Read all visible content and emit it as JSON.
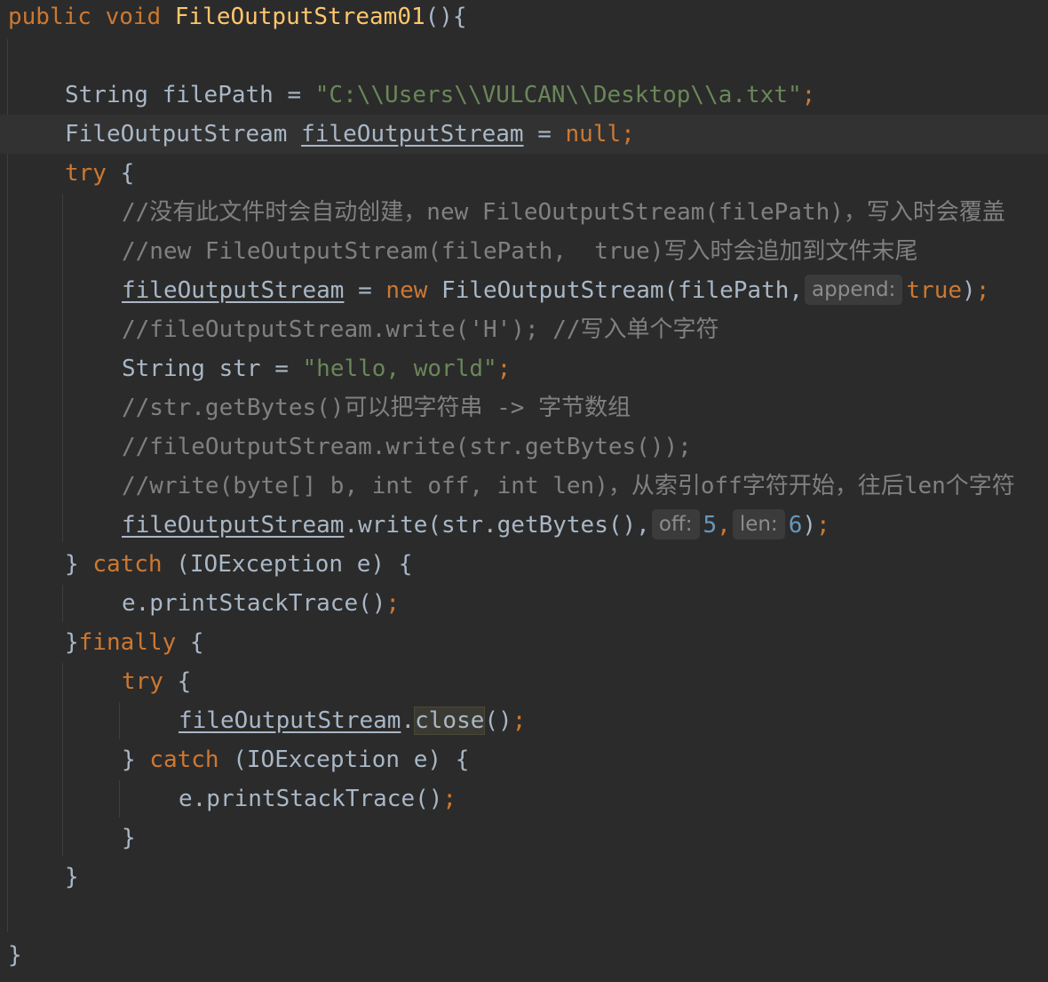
{
  "code": {
    "l1": {
      "mod": "public",
      "type": "void",
      "name": "FileOutputStream01",
      "open": "(){"
    },
    "l3": {
      "type": "String",
      "var": "filePath",
      "eq": " = ",
      "val": "\"C:\\\\Users\\\\VULCAN\\\\Desktop\\\\a.txt\"",
      "semi": ";"
    },
    "l4": {
      "type": "FileOutputStream",
      "var": "fileOutputStream",
      "eq": " = ",
      "val": "null",
      "semi": ";"
    },
    "l5": {
      "kw": "try",
      "rest": " {"
    },
    "l6": {
      "comment": "//没有此文件时会自动创建，new FileOutputStream(filePath)，写入时会覆盖"
    },
    "l7": {
      "comment": "//new FileOutputStream(filePath,  true)写入时会追加到文件末尾"
    },
    "l8": {
      "var": "fileOutputStream",
      "eq": " = ",
      "kw": "new",
      "call": " FileOutputStream(filePath,",
      "hint": "append:",
      "val": "true",
      "close": ")",
      "semi": ";"
    },
    "l9": {
      "comment": "//fileOutputStream.write('H'); //写入单个字符"
    },
    "l10": {
      "type": "String",
      "var": " str",
      "eq": " = ",
      "val": "\"hello, world\"",
      "semi": ";"
    },
    "l11": {
      "comment": "//str.getBytes()可以把字符串 -> 字节数组"
    },
    "l12": {
      "comment": "//fileOutputStream.write(str.getBytes());"
    },
    "l13": {
      "comment": "//write(byte[] b, int off, int len)，从索引off字符开始，往后len个字符"
    },
    "l14": {
      "var": "fileOutputStream",
      "call": ".write(str.getBytes(),",
      "hint1": "off:",
      "num1": "5",
      "comma": ",",
      "hint2": "len:",
      "num2": "6",
      "close": ")",
      "semi": ";"
    },
    "l15": {
      "brace": "} ",
      "kw": "catch",
      "rest": " (IOException e) {"
    },
    "l16": {
      "call": "e.printStackTrace()",
      "semi": ";"
    },
    "l17": {
      "brace": "}",
      "kw": "finally",
      "rest": " {"
    },
    "l18": {
      "kw": "try",
      "rest": " {"
    },
    "l19": {
      "var": "fileOutputStream",
      "dot": ".",
      "method": "close",
      "rest": "()",
      "semi": ";"
    },
    "l20": {
      "brace": "} ",
      "kw": "catch",
      "rest": " (IOException e) {"
    },
    "l21": {
      "call": "e.printStackTrace()",
      "semi": ";"
    },
    "l22": {
      "brace": "}"
    },
    "l23": {
      "brace": "}"
    },
    "l25": {
      "brace": "}"
    }
  },
  "colors": {
    "background": "#2b2b2b",
    "current_line": "#323232",
    "keyword": "#cc7832",
    "method_decl": "#ffc66d",
    "string": "#6a8759",
    "comment": "#808080",
    "number": "#6897bb",
    "plain": "#a9b7c6"
  }
}
